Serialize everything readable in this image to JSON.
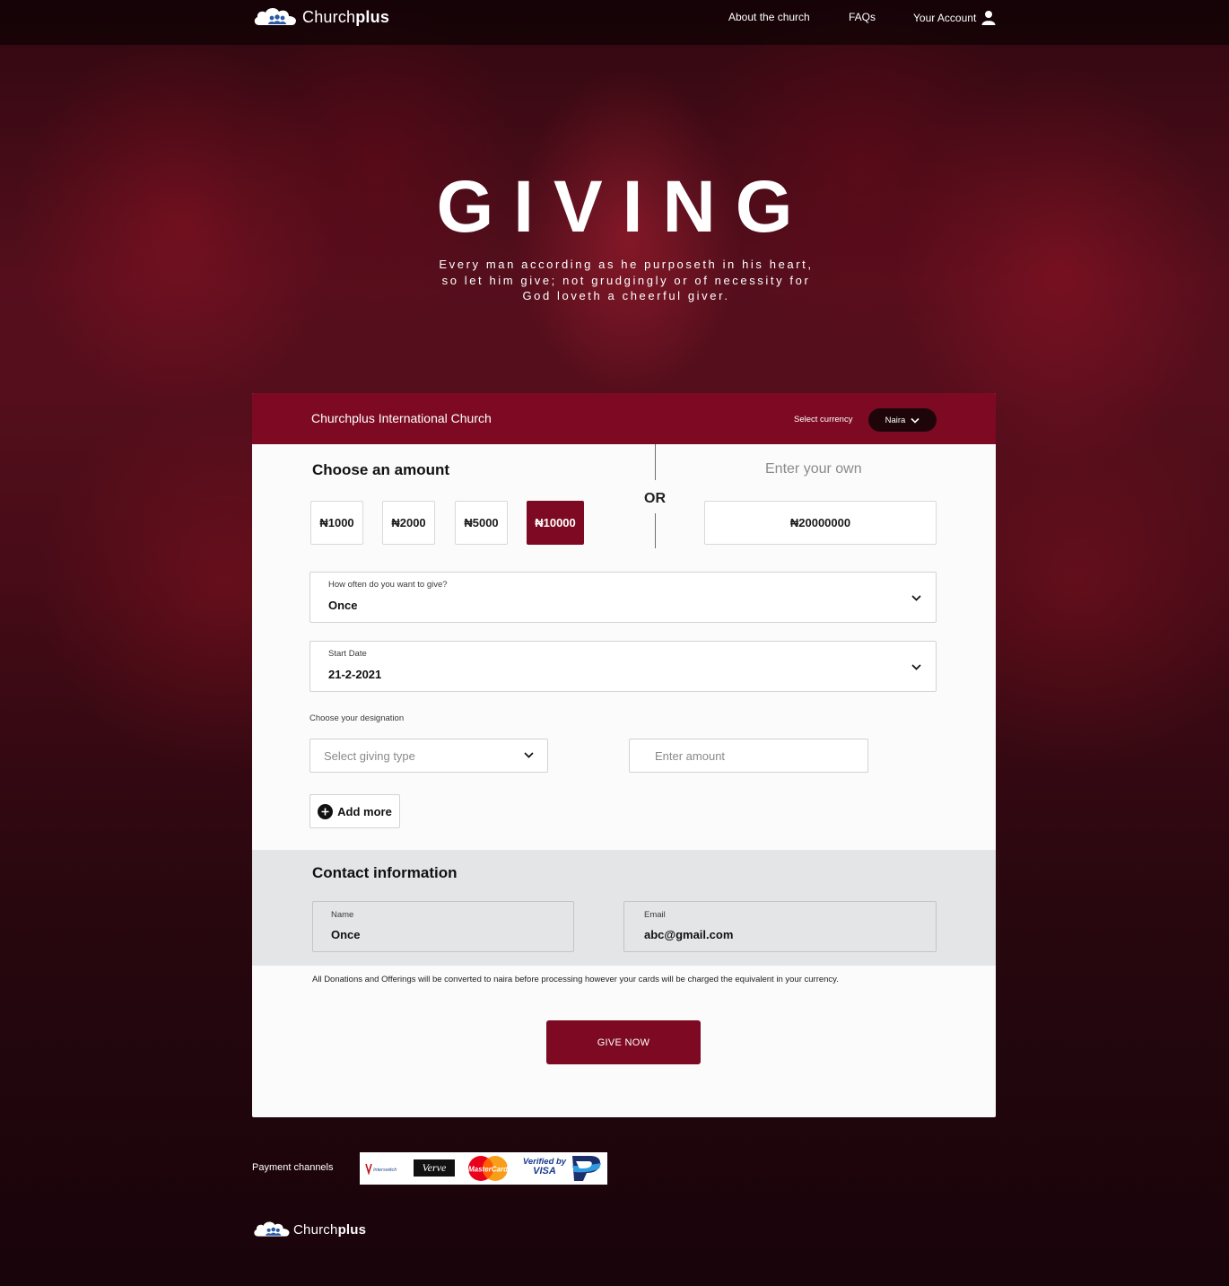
{
  "header": {
    "brand_light": "Church",
    "brand_bold": "plus",
    "nav": {
      "about": "About the church",
      "faqs": "FAQs",
      "account": "Your Account"
    }
  },
  "hero": {
    "title": "GIVING",
    "verse_line1": "Every man according as he purposeth in his heart,",
    "verse_line2": "so let him give; not grudgingly or of necessity for",
    "verse_line3": "God loveth a cheerful giver."
  },
  "form": {
    "church_name": "Churchplus International Church",
    "currency_label": "Select currency",
    "currency_value": "Naira",
    "choose_amount": "Choose an amount",
    "enter_own": "Enter your own",
    "or": "OR",
    "amounts": [
      "₦1000",
      "₦2000",
      "₦5000",
      "₦10000"
    ],
    "selected_amount_index": 3,
    "own_amount": "₦20000000",
    "frequency": {
      "label": "How often do you want to give?",
      "value": "Once"
    },
    "start_date": {
      "label": "Start Date",
      "value": "21-2-2021"
    },
    "designation_label": "Choose your designation",
    "giving_type_placeholder": "Select giving type",
    "amount_placeholder": "Enter amount",
    "add_more": "Add more"
  },
  "contact": {
    "heading": "Contact information",
    "name": {
      "label": "Name",
      "value": "Once"
    },
    "email": {
      "label": "Email",
      "value": "abc@gmail.com"
    }
  },
  "note": "All Donations and Offerings will be converted to naira before processing however your cards will be charged the equivalent in your currency.",
  "give_button": "GIVE NOW",
  "footer": {
    "payment_label": "Payment channels",
    "logos": {
      "interswitch": "Interswitch",
      "verve": "Verve",
      "mastercard": "MasterCard",
      "visa_top": "Verified by",
      "visa_bottom": "VISA"
    },
    "brand_light": "Church",
    "brand_bold": "plus"
  },
  "colors": {
    "brand": "#7d0a22",
    "header_overlay": "#000000",
    "contact_bg": "#e4e5e7"
  }
}
